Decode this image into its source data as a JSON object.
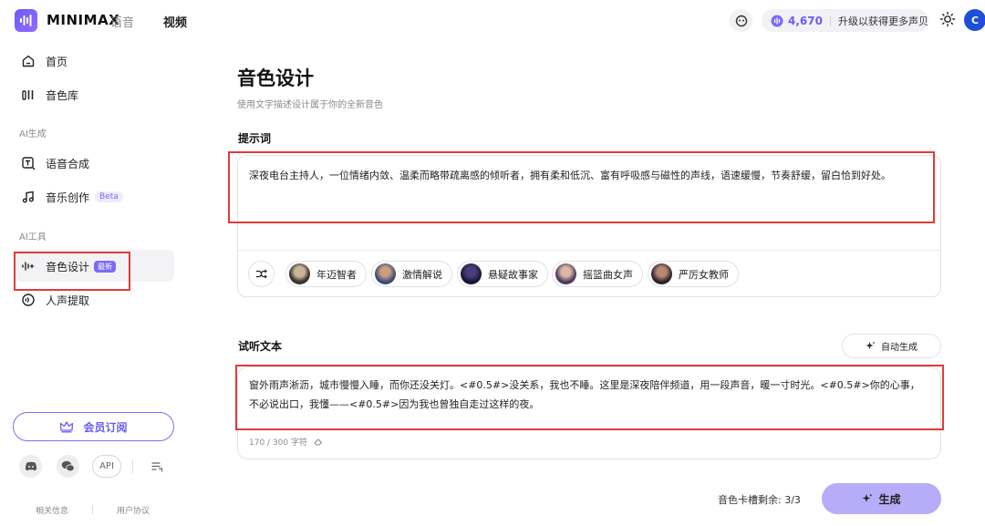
{
  "header": {
    "brand": "MINIMAX",
    "brand_sub": "语音",
    "nav_video": "视频",
    "credits": "4,670",
    "upgrade": "升级以获得更多声贝",
    "avatar_initial": "C"
  },
  "sidebar": {
    "home": "首页",
    "voice_library": "音色库",
    "section_ai_gen": "AI生成",
    "tts": "语音合成",
    "music": "音乐创作",
    "music_badge": "Beta",
    "section_ai_tools": "AI工具",
    "voice_design": "音色设计",
    "voice_design_badge": "最新",
    "vocal_extract": "人声提取",
    "member": "会员订阅",
    "api": "API",
    "footer_about": "相关信息",
    "footer_terms": "用户协议"
  },
  "main": {
    "title": "音色设计",
    "subtitle": "使用文字描述设计属于你的全新音色",
    "prompt_label": "提示词",
    "prompt_text": "深夜电台主持人，一位情绪内敛、温柔而略带疏离感的倾听者，拥有柔和低沉、富有呼吸感与磁性的声线，语速缓慢，节奏舒缓，留白恰到好处。",
    "presets": [
      "年迈智者",
      "激情解说",
      "悬疑故事家",
      "摇篮曲女声",
      "严厉女教师"
    ],
    "preview_label": "试听文本",
    "auto_generate": "自动生成",
    "preview_text": "窗外雨声淅沥，城市慢慢入睡，而你还没关灯。<#0.5#>没关系，我也不睡。这里是深夜陪伴频道，用一段声音，暖一寸时光。<#0.5#>你的心事，不必说出口，我懂——<#0.5#>因为我也曾独自走过这样的夜。",
    "char_count": "170 / 300 字符",
    "slots": "音色卡槽剩余:  3/3",
    "generate": "生成"
  },
  "colors": {
    "accent": "#6b5cf0",
    "generate_bg": "#b6acf7",
    "highlight_box": "#e03b3b"
  }
}
